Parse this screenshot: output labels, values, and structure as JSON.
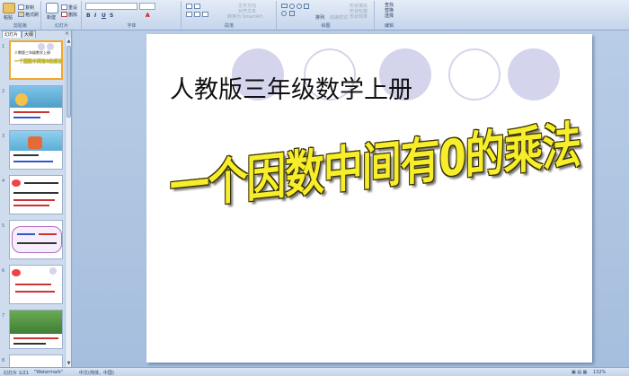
{
  "ribbon": {
    "clipboard": {
      "paste": "粘贴",
      "copy": "复制",
      "format_painter": "格式刷",
      "group": "剪贴板"
    },
    "slides": {
      "new_slide": "新建",
      "layout": "重设",
      "delete": "删除",
      "group": "幻灯片"
    },
    "font": {
      "group": "字体"
    },
    "paragraph": {
      "text_direction": "文字方向",
      "align_text": "对齐文本",
      "smartart": "转换为 SmartArt",
      "group": "段落"
    },
    "drawing": {
      "arrange": "排列",
      "quick_styles": "快速样式",
      "shape_fill": "形状填充",
      "shape_outline": "形状轮廓",
      "shape_effects": "形状效果",
      "group": "绘图"
    },
    "editing": {
      "find": "查找",
      "replace": "替换",
      "select": "选择",
      "group": "编辑"
    }
  },
  "left_pane": {
    "tab_slides": "幻灯片",
    "tab_outline": "大纲",
    "close": "×",
    "slide_numbers": [
      "1",
      "2",
      "3",
      "4",
      "5",
      "6",
      "7",
      "8"
    ],
    "thumb1": {
      "line1": "人教版三年级数学上册",
      "line2": "一个因数中间有0的乘法"
    }
  },
  "slide": {
    "subtitle": "人教版三年级数学上册",
    "title": "一个因数中间有0的乘法",
    "circle_color": "#d4d4ec"
  },
  "status": {
    "slide_count": "幻灯片 1/21",
    "theme": "\"Watermark\"",
    "language": "中文(简体，中国)",
    "zoom": "132%"
  }
}
